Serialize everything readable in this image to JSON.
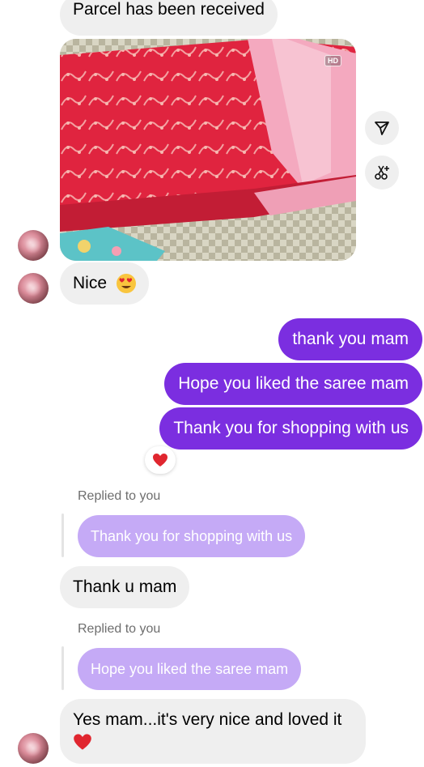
{
  "messages": {
    "parcel": "Parcel has been received",
    "photo_badge": "HD",
    "nice": "Nice",
    "thank_you_mam": "thank you mam",
    "hope_liked": "Hope you liked the saree mam",
    "thank_shopping": "Thank you for shopping with us",
    "reply1_label": "Replied to you",
    "reply1_quote": "Thank you for shopping with us",
    "thank_u_mam": "Thank u mam",
    "reply2_label": "Replied to you",
    "reply2_quote": "Hope you liked the saree mam",
    "yes_mam": "Yes mam...it's very nice and loved it"
  },
  "icons": {
    "send": "share-send-icon",
    "ai_edit": "sparkle-edit-icon",
    "heart": "red-heart-emoji",
    "heart_eyes": "heart-eyes-emoji"
  },
  "colors": {
    "incoming_bubble": "#efefef",
    "outgoing_bubble": "#7b2ee0",
    "reply_bubble": "#c5aaf6",
    "heart": "#e0262f"
  }
}
